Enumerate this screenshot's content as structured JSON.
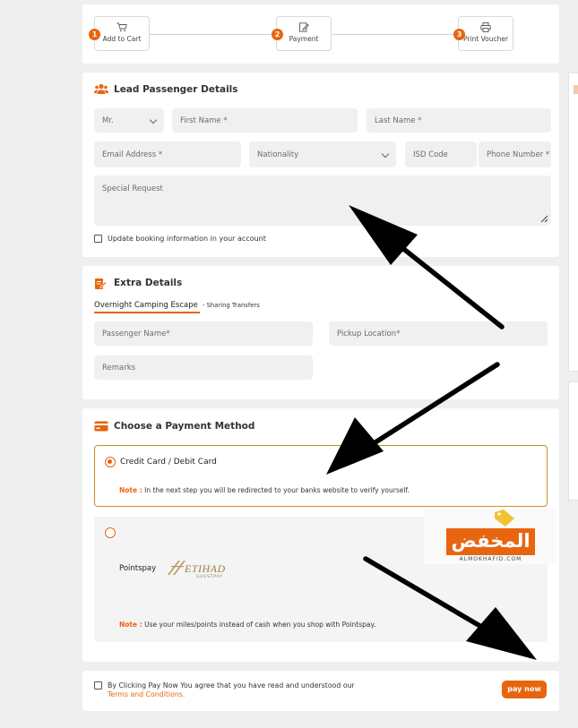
{
  "steps": [
    {
      "number": "1",
      "label": "Add to Cart",
      "icon": "cart-icon"
    },
    {
      "number": "2",
      "label": "Payment",
      "icon": "edit-document-icon"
    },
    {
      "number": "3",
      "label": "Print Voucher",
      "icon": "printer-icon"
    }
  ],
  "lead": {
    "title": "Lead Passenger Details",
    "icon": "users-icon",
    "title_value": "Mr.",
    "first_name_placeholder": "First Name *",
    "last_name_placeholder": "Last Name *",
    "email_placeholder": "Email Address *",
    "nationality_placeholder": "Nationality",
    "isd_placeholder": "ISD Code",
    "phone_placeholder": "Phone Number *",
    "special_request_placeholder": "Special Request",
    "update_booking_label": "Update booking information in your account"
  },
  "extra": {
    "title": "Extra Details",
    "icon": "edit-icon",
    "tour_name": "Overnight Camping Escape",
    "tour_suffix": "- Sharing Transfers",
    "passenger_name_placeholder": "Passenger Name*",
    "pickup_location_placeholder": "Pickup Location*",
    "remarks_placeholder": "Remarks"
  },
  "payment": {
    "title": "Choose a Payment Method",
    "icon": "credit-card-icon",
    "card_option_label": "Credit Card / Debit Card",
    "card_note_label": "Note :",
    "card_note_text": "In the next step you will be redirected to your banks website to verify yourself.",
    "pointspay_label": "Pointspay",
    "etihad_logo_text": "ETIHAD",
    "etihad_logo_sub": "GUESTPAY",
    "pointspay_note_label": "Note :",
    "pointspay_note_text": "Use your miles/points instead of cash when you shop with Pointspay."
  },
  "footer": {
    "terms_text": "By Clicking Pay Now You agree that you have read and understood our",
    "terms_link": "Terms and Conditions.",
    "pay_button": "pay now"
  },
  "watermark": {
    "arabic_text": "المخفض",
    "site_text": "ALMOKHAFID.COM"
  },
  "colors": {
    "accent": "#e8650f",
    "field_bg": "#f0f0f0",
    "page_bg": "#efefef"
  }
}
